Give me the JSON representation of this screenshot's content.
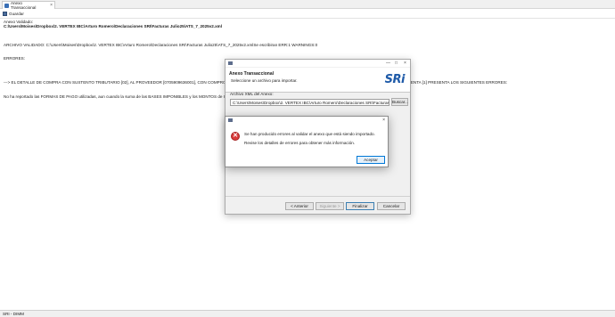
{
  "tab": {
    "title": "Anexo Transaccional",
    "close": "×"
  },
  "toolbar": {
    "save_label": "Guardar"
  },
  "file": {
    "label": "Anexo Validado:",
    "path": "C:\\Users\\Moises\\Dropbox\\2. VERTEX IBC\\Arturo Romero\\Declaraciones SRI\\Facturas Julio25\\ATS_7_2025v2.xml"
  },
  "log": [
    "ARCHIVO VALIDADO: C:\\Users\\Moises\\Dropbox\\2. VERTEX IBC\\Arturo Romero\\Declaraciones SRI\\Facturas Julio25\\ATS_7_2025v2.xmlSe escribiran ERR:1 WARNINGS:0",
    "ERRORES:",
    "",
    "---> EL DETALLE DE COMPRA CON SUSTENTO TRIBUTARIO [02], AL PROVEEDOR [0705909636001], CON COMPROBANTE TIPO [02], ESTABLECIMIENTO [001], PUNTO EMISION [001], NUM. COMPROBANTE DE VENTA [1] PRESENTA LOS SIGUIENTES ERRORES:",
    "No ha reportado las FORMAS DE PAGO utilizadas, aun cuando la suma de las BASES IMPONIBLES y los MONTOS de IVA e ICE exceden los USD. 500.00"
  ],
  "status": "SRI - DIMM",
  "wizard": {
    "title": "Anexo Transaccional",
    "subtitle": "Seleccione un archivo para importar.",
    "logo": "SRi",
    "xml_label": "Archivo XML del Anexo:",
    "xml_value": "C:\\Users\\Moises\\Dropbox\\2. VERTEX IBC\\Arturo Romero\\Declaraciones SRI\\Facturas Julio25\\",
    "browse": "Buscar...",
    "back": "< Anterior",
    "next": "Siguiente >",
    "finish": "Finalizar",
    "cancel": "Cancelar",
    "ctrl_min": "—",
    "ctrl_max": "□",
    "ctrl_close": "×"
  },
  "error_dialog": {
    "close": "×",
    "icon_glyph": "✕",
    "message1": "Se han producido errores al validar el anexo que está siendo importado.",
    "message2": "Revise los detalles de errores para obtener más información.",
    "ok": "Aceptar"
  },
  "colors": {
    "accent": "#1e5aa8",
    "error": "#d93c3c",
    "brand_dot": "#d8232a"
  }
}
